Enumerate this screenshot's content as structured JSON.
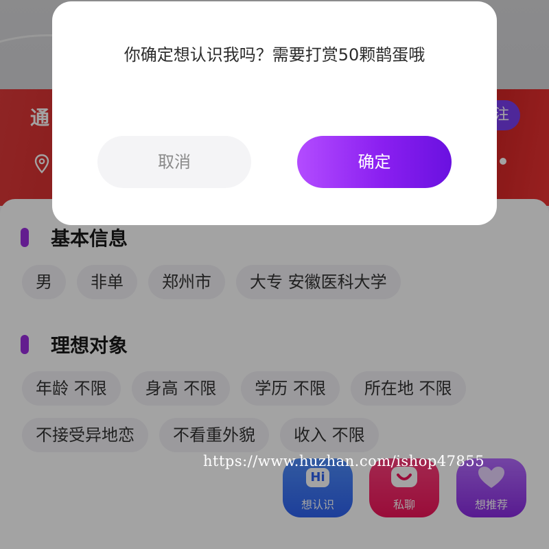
{
  "profile": {
    "name_partial": "通",
    "follow_partial": "注"
  },
  "basic_info": {
    "title": "基本信息",
    "tags": [
      "男",
      "非单",
      "郑州市",
      "大专 安徽医科大学"
    ]
  },
  "ideal_partner": {
    "title": "理想对象",
    "tags_row1": [
      "年龄 不限",
      "身高 不限",
      "学历 不限",
      "所在地 不限"
    ],
    "tags_row2": [
      "不接受异地恋",
      "不看重外貌",
      "收入 不限"
    ]
  },
  "actions": {
    "hi_glyph": "Hi",
    "want_to_know": "想认识",
    "private_chat": "私聊",
    "recommend": "想推荐"
  },
  "watermark": "https://www.huzhan.com/ishop47855",
  "dialog": {
    "message": "你确定想认识我吗？需要打赏50颗鹊蛋哦",
    "cancel": "取消",
    "confirm": "确定"
  },
  "colors": {
    "accent_purple": "#8a1ff0",
    "section_bar": "#9b2ee0"
  },
  "icons": [
    "location-pin-icon",
    "hi-icon",
    "chat-smile-icon",
    "heart-icon"
  ]
}
